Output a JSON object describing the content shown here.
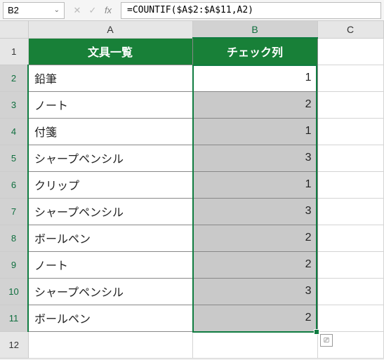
{
  "formula_bar": {
    "name_box": "B2",
    "formula": "=COUNTIF($A$2:$A$11,A2)"
  },
  "columns": [
    "A",
    "B",
    "C"
  ],
  "rows": [
    "1",
    "2",
    "3",
    "4",
    "5",
    "6",
    "7",
    "8",
    "9",
    "10",
    "11",
    "12"
  ],
  "headers": {
    "a": "文具一覧",
    "b": "チェック列"
  },
  "data": [
    {
      "a": "鉛筆",
      "b": "1"
    },
    {
      "a": "ノート",
      "b": "2"
    },
    {
      "a": "付箋",
      "b": "1"
    },
    {
      "a": "シャープペンシル",
      "b": "3"
    },
    {
      "a": "クリップ",
      "b": "1"
    },
    {
      "a": "シャープペンシル",
      "b": "3"
    },
    {
      "a": "ボールペン",
      "b": "2"
    },
    {
      "a": "ノート",
      "b": "2"
    },
    {
      "a": "シャープペンシル",
      "b": "3"
    },
    {
      "a": "ボールペン",
      "b": "2"
    }
  ],
  "selection": {
    "active_cell": "B2",
    "range": "B2:B11",
    "selected_col": "B",
    "selected_rows_from": 2,
    "selected_rows_to": 11
  },
  "icons": {
    "dropdown": "⌄",
    "cancel": "✕",
    "enter": "✓",
    "fx": "fx",
    "quick_analysis": "⎚"
  }
}
